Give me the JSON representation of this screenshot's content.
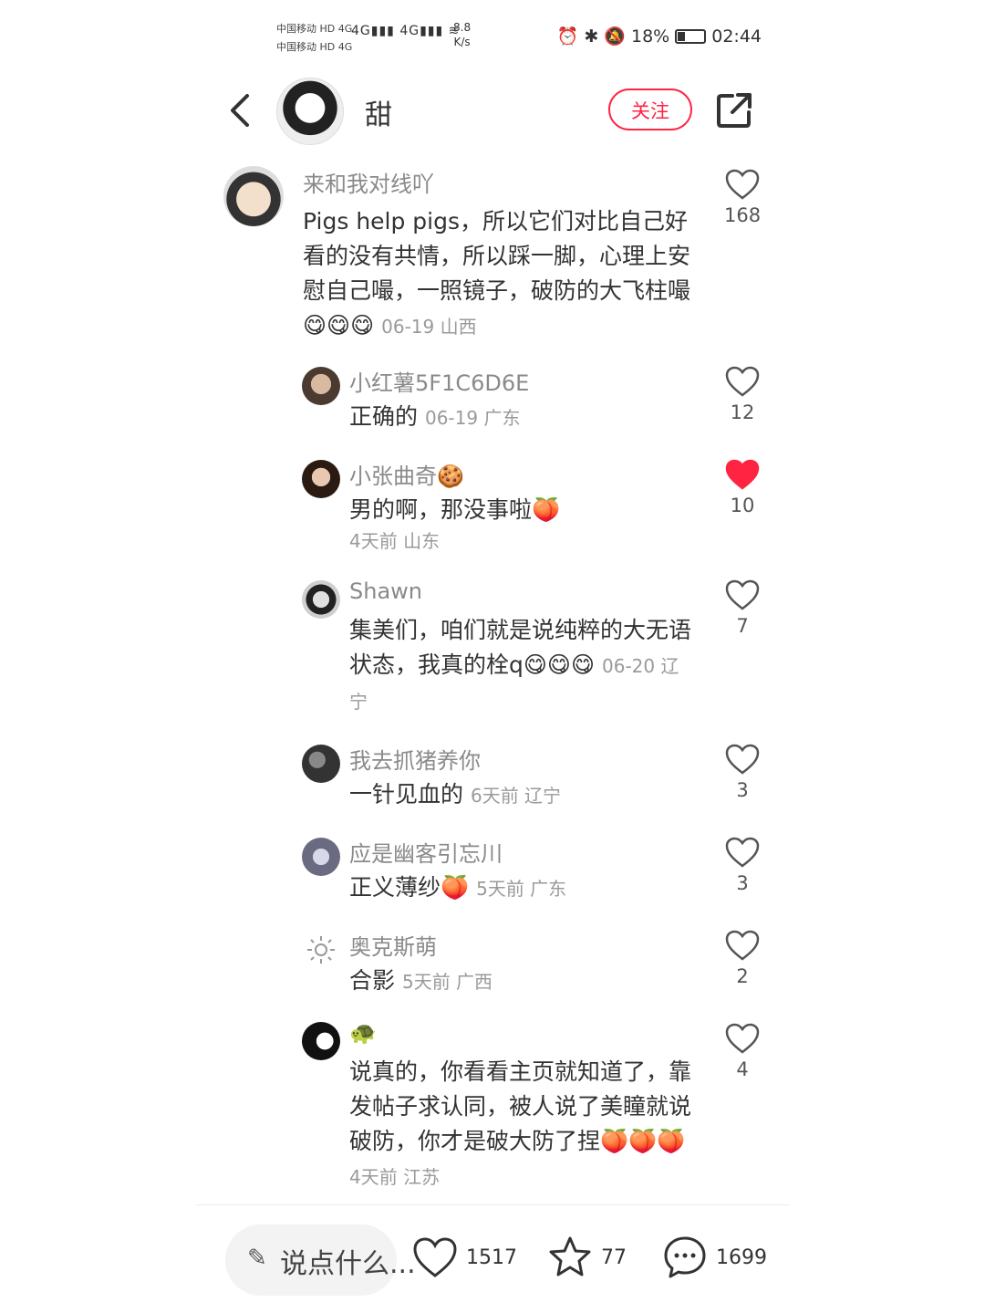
{
  "status": {
    "carrier1": "中国移动 HD 4G",
    "carrier2": "中国移动 HD 4G",
    "signal": "4G▮▮▮ 4G▮▮▮ ≋",
    "speed_value": "8.8",
    "speed_unit": "K/s",
    "icons": "⏰ ✱ 🔕",
    "battery": "18%",
    "time": "02:44"
  },
  "header": {
    "author": "甜",
    "follow_label": "关注"
  },
  "comments": [
    {
      "user": "来和我对线吖",
      "text": "Pigs help pigs，所以它们对比自己好看的没有共情，所以踩一脚，心理上安慰自己嘬，一照镜子，破防的大飞柱嘬😋😋😋",
      "meta": "06-19 山西",
      "likes": "168",
      "liked": false
    },
    {
      "user": "小红薯5F1C6D6E",
      "text": "正确的",
      "meta": "06-19 广东",
      "likes": "12",
      "liked": false
    },
    {
      "user": "小张曲奇🍪",
      "text": "男的啊，那没事啦🍑",
      "meta": "4天前  山东",
      "likes": "10",
      "liked": true
    },
    {
      "user": "Shawn",
      "text": "集美们，咱们就是说纯粹的大无语状态，我真的栓q😋😋😋",
      "meta": "06-20 辽宁",
      "likes": "7",
      "liked": false
    },
    {
      "user": "我去抓猪养你",
      "text": "一针见血的",
      "meta": "6天前  辽宁",
      "likes": "3",
      "liked": false
    },
    {
      "user": "应是幽客引忘川",
      "text": "正义薄纱🍑",
      "meta": "5天前  广东",
      "likes": "3",
      "liked": false
    },
    {
      "user": "奥克斯萌",
      "text": "合影",
      "meta": "5天前  广西",
      "likes": "2",
      "liked": false
    },
    {
      "user": "🐢",
      "text": "说真的，你看看主页就知道了，靠发帖子求认同，被人说了美瞳就说破防，你才是破大防了捏🍑🍑🍑",
      "meta": "4天前  江苏",
      "likes": "4",
      "liked": false
    }
  ],
  "bottom": {
    "placeholder": "说点什么...",
    "likes": "1517",
    "stars": "77",
    "comments": "1699"
  },
  "colors": {
    "accent": "#ff2442",
    "gray_text": "#8a8a8a"
  }
}
